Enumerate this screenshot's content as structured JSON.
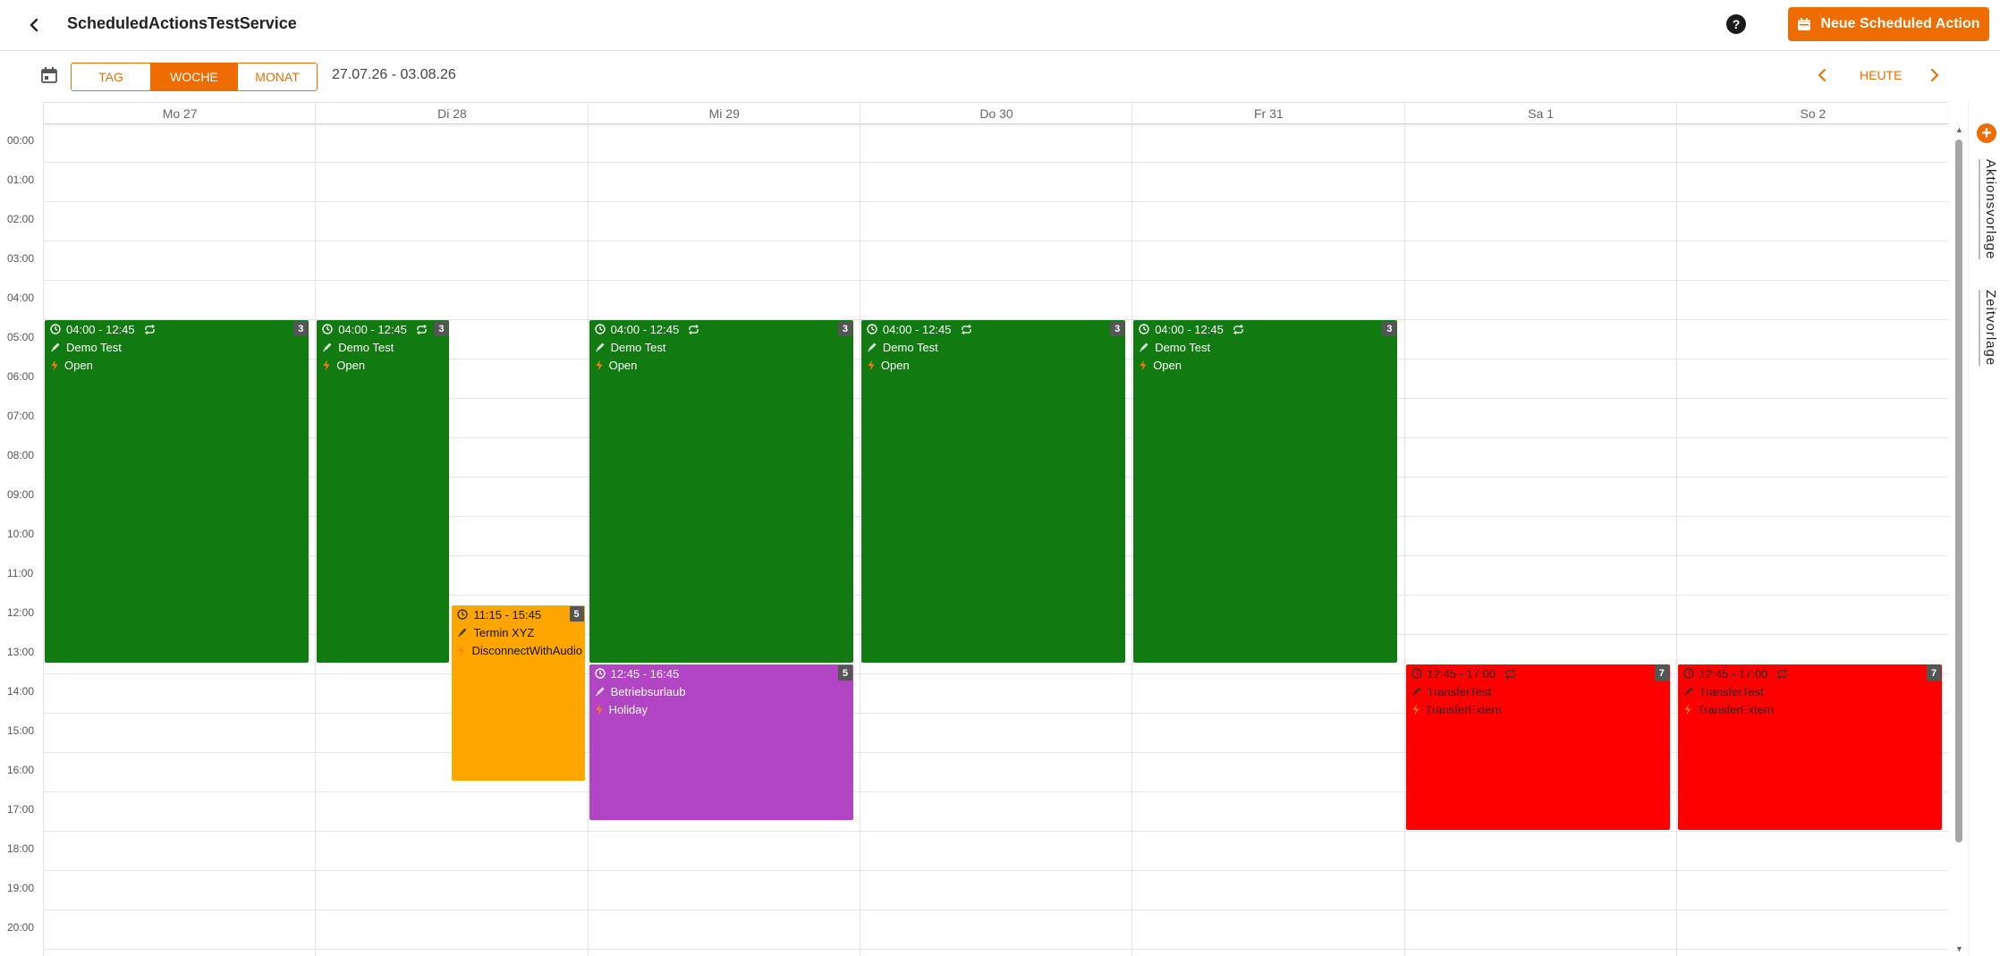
{
  "header": {
    "title": "ScheduledActionsTestService",
    "help_label": "?",
    "new_button_label": "Neue Scheduled Action"
  },
  "toolbar": {
    "views": [
      "TAG",
      "WOCHE",
      "MONAT"
    ],
    "active_view": "WOCHE",
    "date_range": "27.07.26 - 03.08.26",
    "today_label": "HEUTE"
  },
  "calendar": {
    "days": [
      "Mo 27",
      "Di 28",
      "Mi 29",
      "Do 30",
      "Fr 31",
      "Sa 1",
      "So 2"
    ],
    "hours": [
      "00:00",
      "01:00",
      "02:00",
      "03:00",
      "04:00",
      "05:00",
      "06:00",
      "07:00",
      "08:00",
      "09:00",
      "10:00",
      "11:00",
      "12:00",
      "13:00",
      "14:00",
      "15:00",
      "16:00",
      "17:00",
      "18:00",
      "19:00",
      "20:00"
    ],
    "events": [
      {
        "day": 0,
        "start": "04:00",
        "end": "12:45",
        "time": "04:00 - 12:45",
        "recurring": true,
        "name": "Demo Test",
        "action": "Open",
        "count": "3",
        "color": "#117a11",
        "lane": "full"
      },
      {
        "day": 1,
        "start": "04:00",
        "end": "12:45",
        "time": "04:00 - 12:45",
        "recurring": true,
        "name": "Demo Test",
        "action": "Open",
        "count": "3",
        "color": "#117a11",
        "lane": "left"
      },
      {
        "day": 1,
        "start": "11:15",
        "end": "15:45",
        "time": "11:15 - 15:45",
        "recurring": false,
        "name": "Termin XYZ",
        "action": "DisconnectWithAudio",
        "count": "5",
        "color": "#ffa500",
        "lane": "right"
      },
      {
        "day": 2,
        "start": "04:00",
        "end": "12:45",
        "time": "04:00 - 12:45",
        "recurring": true,
        "name": "Demo Test",
        "action": "Open",
        "count": "3",
        "color": "#117a11",
        "lane": "full"
      },
      {
        "day": 2,
        "start": "12:45",
        "end": "16:45",
        "time": "12:45 - 16:45",
        "recurring": false,
        "name": "Betriebsurlaub",
        "action": "Holiday",
        "count": "5",
        "color": "#b145c4",
        "lane": "full"
      },
      {
        "day": 3,
        "start": "04:00",
        "end": "12:45",
        "time": "04:00 - 12:45",
        "recurring": true,
        "name": "Demo Test",
        "action": "Open",
        "count": "3",
        "color": "#117a11",
        "lane": "full"
      },
      {
        "day": 4,
        "start": "04:00",
        "end": "12:45",
        "time": "04:00 - 12:45",
        "recurring": true,
        "name": "Demo Test",
        "action": "Open",
        "count": "3",
        "color": "#117a11",
        "lane": "full"
      },
      {
        "day": 5,
        "start": "12:45",
        "end": "17:00",
        "time": "12:45 - 17:00",
        "recurring": true,
        "name": "TransferTest",
        "action": "TransferExtern",
        "count": "7",
        "color": "#ff0000",
        "lane": "full"
      },
      {
        "day": 6,
        "start": "12:45",
        "end": "17:00",
        "time": "12:45 - 17:00",
        "recurring": true,
        "name": "TransferTest",
        "action": "TransferExtern",
        "count": "7",
        "color": "#ff0000",
        "lane": "full"
      }
    ]
  },
  "side_panel": {
    "tabs": [
      "Aktionsvorlage",
      "Zeitvorlage"
    ],
    "add_label": "+"
  },
  "colors": {
    "accent": "#ef6c00",
    "green": "#117a11",
    "orange": "#ffa500",
    "purple": "#b145c4",
    "red": "#ff0000"
  }
}
